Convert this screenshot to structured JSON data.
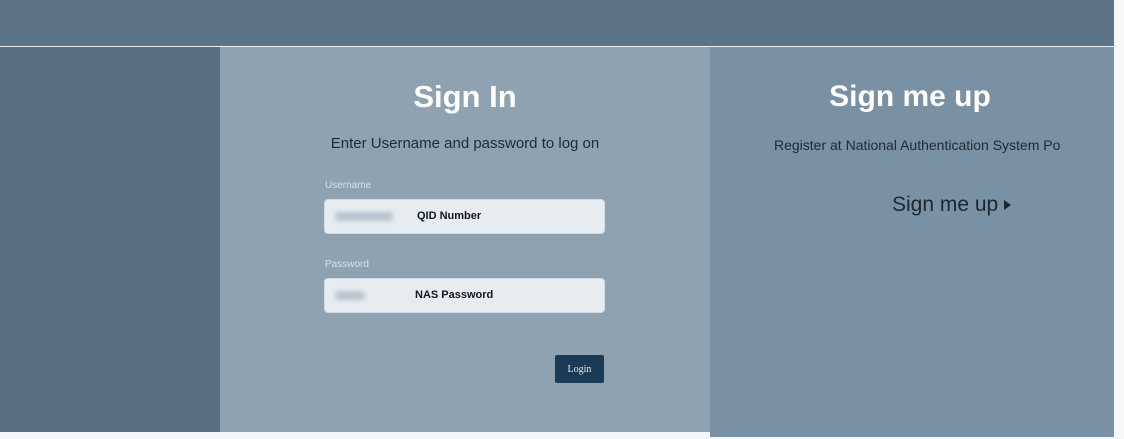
{
  "signin": {
    "title": "Sign In",
    "subtitle": "Enter Username and password to log on",
    "username_label": "Username",
    "username_placeholder": "QID Number",
    "password_label": "Password",
    "password_placeholder": "NAS Password",
    "login_label": "Login"
  },
  "signup": {
    "title": "Sign me up",
    "subtitle": "Register at National Authentication System Po",
    "link_label": "Sign me up",
    "link_icon": "play-icon"
  },
  "colors": {
    "top_bar": "#5c7486",
    "signin_panel": "#8ea2b2",
    "signup_panel": "#7a91a3",
    "login_button": "#1b3a56"
  }
}
